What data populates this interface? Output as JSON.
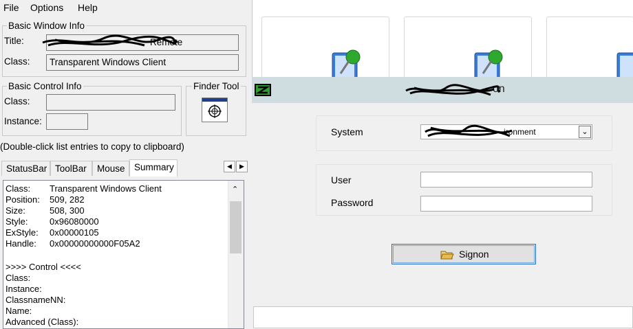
{
  "menu": {
    "file": "File",
    "options": "Options",
    "help": "Help"
  },
  "basic_window": {
    "legend": "Basic Window Info",
    "title_label": "Title:",
    "title_value": "Remote",
    "class_label": "Class:",
    "class_value": "Transparent Windows Client"
  },
  "basic_control": {
    "legend": "Basic Control Info",
    "class_label": "Class:",
    "instance_label": "Instance:"
  },
  "finder": {
    "legend": "Finder Tool"
  },
  "hint": "(Double-click list entries to copy to clipboard)",
  "tabs": [
    "StatusBar",
    "ToolBar",
    "Mouse",
    "Summary"
  ],
  "summary": {
    "lines": [
      {
        "k": "Class:",
        "v": "Transparent Windows Client"
      },
      {
        "k": "Position:",
        "v": "509, 282"
      },
      {
        "k": "Size:",
        "v": "508, 300"
      },
      {
        "k": "Style:",
        "v": "0x96080000"
      },
      {
        "k": "ExStyle:",
        "v": "0x00000105"
      },
      {
        "k": "Handle:",
        "v": "0x00000000000F05A2"
      }
    ],
    "control_header": ">>>> Control <<<<",
    "control_lines": [
      "Class:",
      "Instance:",
      "ClassnameNN:",
      "Name:",
      "Advanced (Class):"
    ]
  },
  "signon": {
    "title": "on",
    "system_label": "System",
    "system_value": "ironment",
    "user_label": "User",
    "password_label": "Password",
    "signon_button": "Signon"
  },
  "colors": {
    "titlebar": "#cfdde0",
    "accent": "#2b6fc7"
  }
}
